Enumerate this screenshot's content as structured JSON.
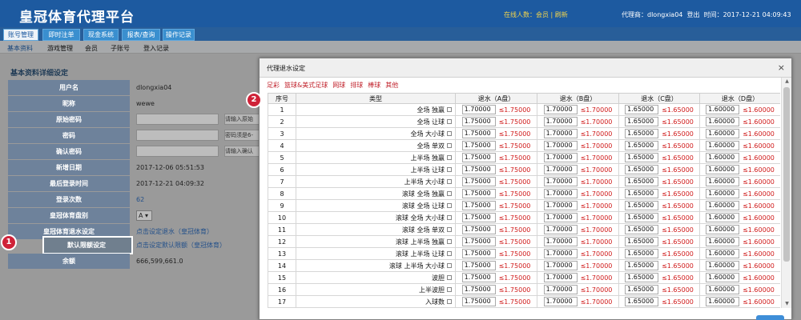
{
  "header": {
    "app_title": "皇冠体育代理平台",
    "online_label": "在线人数：",
    "online_value": "会员",
    "online_sep": " | ",
    "refresh_label": "刷新",
    "agent_text": "代理商：dlongxia04",
    "logout_label": "登出",
    "time_text": "时间：2017-12-21 04:09:43"
  },
  "nav": {
    "tabs": [
      "账号管理",
      "即时注单",
      "现金系统",
      "报表/查询",
      "操作记录"
    ],
    "active_tab": "账号管理"
  },
  "subnav": {
    "items": [
      "基本资料",
      "游戏管理",
      "会员",
      "子账号",
      "登入记录"
    ],
    "active": "基本资料"
  },
  "profile": {
    "title": "基本资料详细设定",
    "rows": [
      {
        "label": "用户名",
        "value": "dlongxia04"
      },
      {
        "label": "昵称",
        "value": "wewe"
      },
      {
        "label": "原始密码",
        "value": "",
        "hint": "请输入原始"
      },
      {
        "label": "密码",
        "value": "",
        "hint": "密码须是6-"
      },
      {
        "label": "确认密码",
        "value": "",
        "hint": "请输入确认"
      },
      {
        "label": "新增日期",
        "value": "2017-12-06 05:51:53"
      },
      {
        "label": "最后登录时间",
        "value": "2017-12-21 04:09:32"
      },
      {
        "label": "登录次数",
        "value": "62"
      },
      {
        "label": "皇冠体育盘别",
        "value": "A ▾"
      },
      {
        "label": "皇冠体育退水设定",
        "value": "点击设定退水（皇冠体育）"
      },
      {
        "label": "默认限额设定",
        "value": "点击设定默认限额（皇冠体育）"
      },
      {
        "label": "余额",
        "value": "666,599,661.0"
      }
    ]
  },
  "callouts": {
    "one": "1",
    "two": "2"
  },
  "modal": {
    "title": "代理退水设定",
    "close": "×",
    "categories": [
      "足彩",
      "篮球&美式足球",
      "网球",
      "排球",
      "棒球",
      "其他"
    ],
    "columns": [
      "序号",
      "类型",
      "退水（A盘）",
      "退水（B盘）",
      "退水（C盘）",
      "退水（D盘）"
    ],
    "rows": [
      {
        "no": "1",
        "type": "全场 独赢",
        "a": "1.70000",
        "al": "≤1.75000",
        "b": "1.70000",
        "bl": "≤1.70000",
        "c": "1.65000",
        "cl": "≤1.65000",
        "d": "1.60000",
        "dl": "≤1.60000"
      },
      {
        "no": "2",
        "type": "全场 让球",
        "a": "1.75000",
        "al": "≤1.75000",
        "b": "1.70000",
        "bl": "≤1.70000",
        "c": "1.65000",
        "cl": "≤1.65000",
        "d": "1.60000",
        "dl": "≤1.60000"
      },
      {
        "no": "3",
        "type": "全场 大小球",
        "a": "1.75000",
        "al": "≤1.75000",
        "b": "1.70000",
        "bl": "≤1.70000",
        "c": "1.65000",
        "cl": "≤1.65000",
        "d": "1.60000",
        "dl": "≤1.60000"
      },
      {
        "no": "4",
        "type": "全场 单双",
        "a": "1.75000",
        "al": "≤1.75000",
        "b": "1.70000",
        "bl": "≤1.70000",
        "c": "1.65000",
        "cl": "≤1.65000",
        "d": "1.60000",
        "dl": "≤1.60000"
      },
      {
        "no": "5",
        "type": "上半场 独赢",
        "a": "1.75000",
        "al": "≤1.75000",
        "b": "1.70000",
        "bl": "≤1.70000",
        "c": "1.65000",
        "cl": "≤1.65000",
        "d": "1.60000",
        "dl": "≤1.60000"
      },
      {
        "no": "6",
        "type": "上半场 让球",
        "a": "1.75000",
        "al": "≤1.75000",
        "b": "1.70000",
        "bl": "≤1.70000",
        "c": "1.65000",
        "cl": "≤1.65000",
        "d": "1.60000",
        "dl": "≤1.60000"
      },
      {
        "no": "7",
        "type": "上半场 大小球",
        "a": "1.75000",
        "al": "≤1.75000",
        "b": "1.70000",
        "bl": "≤1.70000",
        "c": "1.65000",
        "cl": "≤1.65000",
        "d": "1.60000",
        "dl": "≤1.60000"
      },
      {
        "no": "8",
        "type": "滚球 全场 独赢",
        "a": "1.75000",
        "al": "≤1.75000",
        "b": "1.70000",
        "bl": "≤1.70000",
        "c": "1.65000",
        "cl": "≤1.65000",
        "d": "1.60000",
        "dl": "≤1.60000"
      },
      {
        "no": "9",
        "type": "滚球 全场 让球",
        "a": "1.75000",
        "al": "≤1.75000",
        "b": "1.70000",
        "bl": "≤1.70000",
        "c": "1.65000",
        "cl": "≤1.65000",
        "d": "1.60000",
        "dl": "≤1.60000"
      },
      {
        "no": "10",
        "type": "滚球 全场 大小球",
        "a": "1.75000",
        "al": "≤1.75000",
        "b": "1.70000",
        "bl": "≤1.70000",
        "c": "1.65000",
        "cl": "≤1.65000",
        "d": "1.60000",
        "dl": "≤1.60000"
      },
      {
        "no": "11",
        "type": "滚球 全场 单双",
        "a": "1.75000",
        "al": "≤1.75000",
        "b": "1.70000",
        "bl": "≤1.70000",
        "c": "1.65000",
        "cl": "≤1.65000",
        "d": "1.60000",
        "dl": "≤1.60000"
      },
      {
        "no": "12",
        "type": "滚球 上半场 独赢",
        "a": "1.75000",
        "al": "≤1.75000",
        "b": "1.70000",
        "bl": "≤1.70000",
        "c": "1.65000",
        "cl": "≤1.65000",
        "d": "1.60000",
        "dl": "≤1.60000"
      },
      {
        "no": "13",
        "type": "滚球 上半场 让球",
        "a": "1.75000",
        "al": "≤1.75000",
        "b": "1.70000",
        "bl": "≤1.70000",
        "c": "1.65000",
        "cl": "≤1.65000",
        "d": "1.60000",
        "dl": "≤1.60000"
      },
      {
        "no": "14",
        "type": "滚球 上半场 大小球",
        "a": "1.75000",
        "al": "≤1.75000",
        "b": "1.70000",
        "bl": "≤1.70000",
        "c": "1.65000",
        "cl": "≤1.65000",
        "d": "1.60000",
        "dl": "≤1.60000"
      },
      {
        "no": "15",
        "type": "波胆",
        "a": "1.75000",
        "al": "≤1.75000",
        "b": "1.70000",
        "bl": "≤1.70000",
        "c": "1.65000",
        "cl": "≤1.65000",
        "d": "1.60000",
        "dl": "≤1.60000"
      },
      {
        "no": "16",
        "type": "上半波胆",
        "a": "1.75000",
        "al": "≤1.75000",
        "b": "1.70000",
        "bl": "≤1.70000",
        "c": "1.65000",
        "cl": "≤1.65000",
        "d": "1.60000",
        "dl": "≤1.60000"
      },
      {
        "no": "17",
        "type": "入球数",
        "a": "1.75000",
        "al": "≤1.75000",
        "b": "1.70000",
        "bl": "≤1.70000",
        "c": "1.65000",
        "cl": "≤1.65000",
        "d": "1.60000",
        "dl": "≤1.60000"
      }
    ]
  }
}
